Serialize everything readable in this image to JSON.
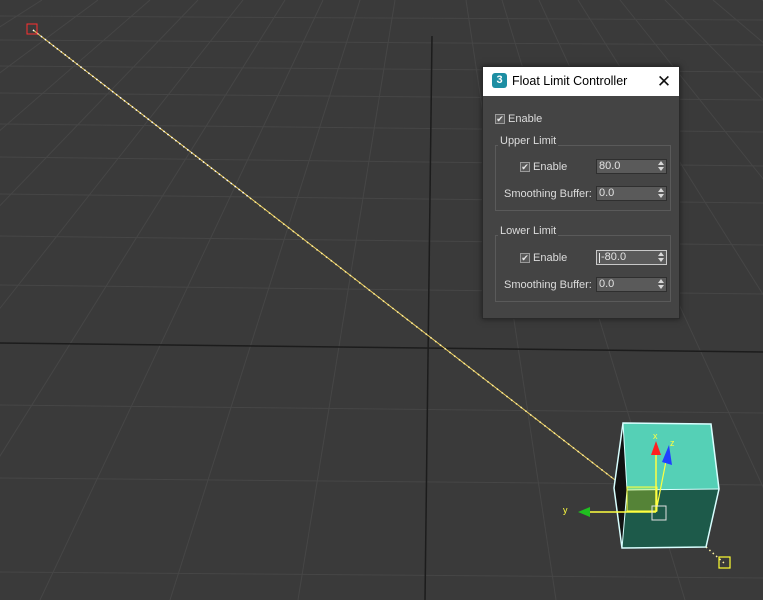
{
  "dialog": {
    "title": "Float Limit Controller",
    "app_icon_glyph": "3",
    "close_glyph": "✕",
    "enable_label": "Enable",
    "enable_checked": true,
    "upper_limit": {
      "title": "Upper Limit",
      "enable_label": "Enable",
      "enable_checked": true,
      "value": "80.0",
      "smoothing_label": "Smoothing Buffer:",
      "smoothing_value": "0.0"
    },
    "lower_limit": {
      "title": "Lower Limit",
      "enable_label": "Enable",
      "enable_checked": true,
      "value": "-80.0",
      "smoothing_label": "Smoothing Buffer:",
      "smoothing_value": "0.0"
    }
  },
  "viewport": {
    "gizmo_axis_y": "y",
    "gizmo_axis_z": "z",
    "gizmo_axis_x": "x",
    "colors": {
      "background": "#3a3a3a",
      "grid": "#474747",
      "grid_major": "#1b1b1b",
      "box_selected": "#4fcfb4",
      "selection_outline": "#c8ffff",
      "path_line": "#e8e860",
      "axis_x": "#ff2020",
      "axis_y": "#20c020",
      "axis_z": "#2040ff",
      "accent": "#1d8ea3"
    }
  }
}
